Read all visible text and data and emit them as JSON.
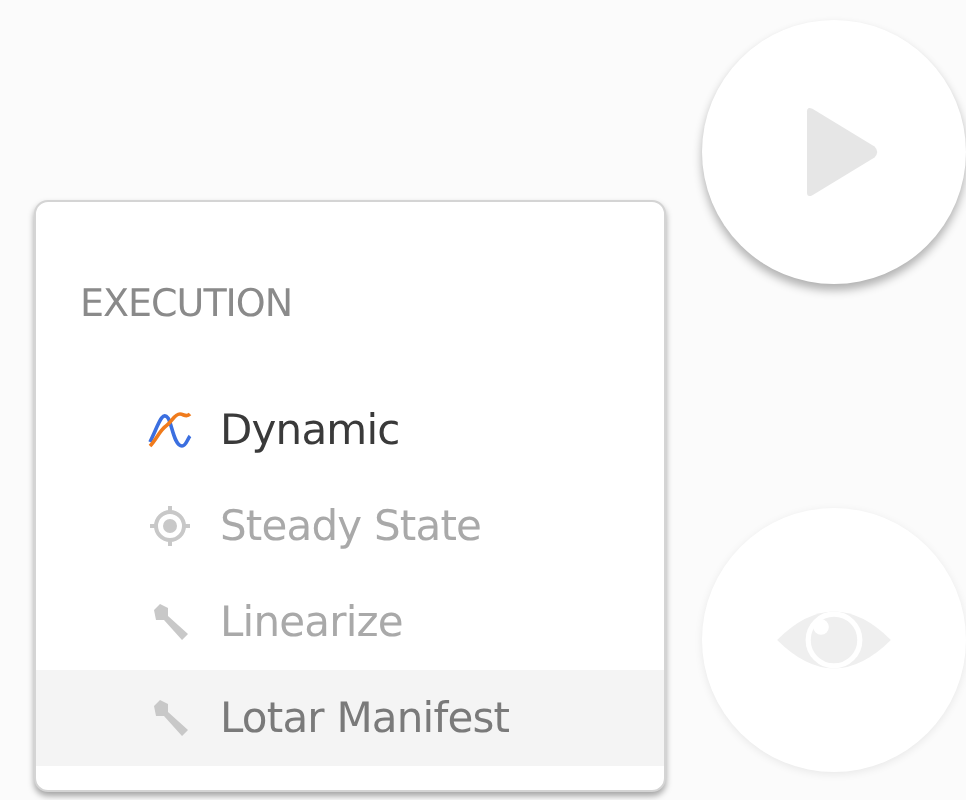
{
  "menu": {
    "heading": "EXECUTION",
    "items": [
      {
        "label": "Dynamic",
        "kind": "wave",
        "disabled": false,
        "highlighted": false
      },
      {
        "label": "Steady State",
        "kind": "target",
        "disabled": true,
        "highlighted": false
      },
      {
        "label": "Linearize",
        "kind": "tool",
        "disabled": true,
        "highlighted": false
      },
      {
        "label": "Lotar Manifest",
        "kind": "tool",
        "disabled": false,
        "highlighted": true
      }
    ]
  },
  "buttons": [
    {
      "kind": "play",
      "disabled": false
    },
    {
      "kind": "view",
      "disabled": true
    }
  ]
}
